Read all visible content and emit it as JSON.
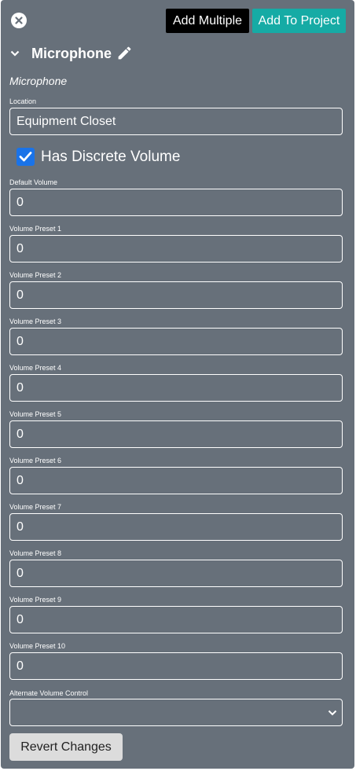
{
  "header": {
    "add_multiple_label": "Add Multiple",
    "add_to_project_label": "Add To Project"
  },
  "section": {
    "title": "Microphone",
    "subtitle": "Microphone"
  },
  "location": {
    "label": "Location",
    "value": "Equipment Closet"
  },
  "discrete_volume": {
    "label": "Has Discrete Volume",
    "checked": true
  },
  "default_volume": {
    "label": "Default Volume",
    "value": "0"
  },
  "presets": [
    {
      "label": "Volume Preset 1",
      "value": "0"
    },
    {
      "label": "Volume Preset 2",
      "value": "0"
    },
    {
      "label": "Volume Preset 3",
      "value": "0"
    },
    {
      "label": "Volume Preset 4",
      "value": "0"
    },
    {
      "label": "Volume Preset 5",
      "value": "0"
    },
    {
      "label": "Volume Preset 6",
      "value": "0"
    },
    {
      "label": "Volume Preset 7",
      "value": "0"
    },
    {
      "label": "Volume Preset 8",
      "value": "0"
    },
    {
      "label": "Volume Preset 9",
      "value": "0"
    },
    {
      "label": "Volume Preset 10",
      "value": "0"
    }
  ],
  "alternate_volume_control": {
    "label": "Alternate Volume Control",
    "value": ""
  },
  "footer": {
    "revert_label": "Revert Changes"
  },
  "icons": {
    "close": "close-circle-icon",
    "chevron": "chevron-down-icon",
    "edit": "pencil-icon",
    "check": "check-icon",
    "select_caret": "chevron-down-icon"
  },
  "colors": {
    "panel_bg": "#67707a",
    "add_multiple_bg": "#000000",
    "add_to_project_bg": "#16aba5",
    "checkbox_bg": "#1a73e8",
    "revert_bg": "#dcdcdc"
  }
}
